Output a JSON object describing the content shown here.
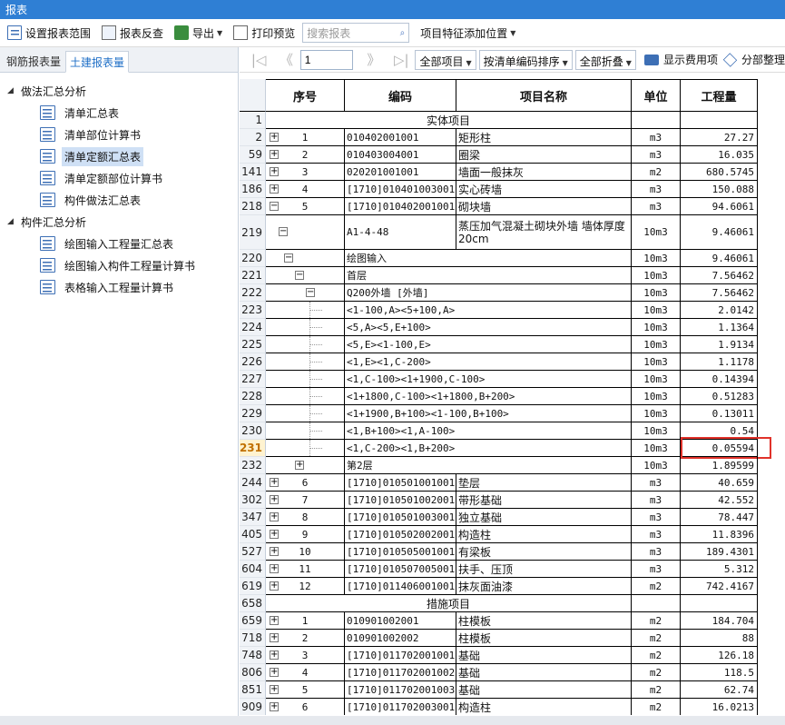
{
  "window": {
    "title": "报表"
  },
  "toolbar": {
    "set_range": "设置报表范围",
    "reverse_check": "报表反查",
    "export": "导出",
    "print_preview": "打印预览",
    "search_placeholder": "搜索报表",
    "feature_add": "项目特征添加位置"
  },
  "tabs": {
    "rebar": "钢筋报表量",
    "civil": "土建报表量"
  },
  "tree": {
    "group1": "做法汇总分析",
    "group1_items": [
      "清单汇总表",
      "清单部位计算书",
      "清单定额汇总表",
      "清单定额部位计算书",
      "构件做法汇总表"
    ],
    "group2": "构件汇总分析",
    "group2_items": [
      "绘图输入工程量汇总表",
      "绘图输入构件工程量计算书",
      "表格输入工程量计算书"
    ]
  },
  "nav": {
    "page": "1",
    "filter": "全部项目",
    "sort": "按清单编码排序",
    "fold": "全部折叠",
    "show_fee": "显示费用项",
    "section_sort": "分部整理"
  },
  "table": {
    "headers": {
      "seq": "序号",
      "code": "编码",
      "name": "项目名称",
      "unit": "单位",
      "qty": "工程量"
    },
    "rows": [
      {
        "rn": "1",
        "type": "section",
        "name": "实体项目"
      },
      {
        "rn": "2",
        "exp": "+",
        "seq": "1",
        "code": "010402001001",
        "name": "矩形柱",
        "unit": "m3",
        "qty": "27.27"
      },
      {
        "rn": "59",
        "exp": "+",
        "seq": "2",
        "code": "010403004001",
        "name": "圈梁",
        "unit": "m3",
        "qty": "16.035"
      },
      {
        "rn": "141",
        "exp": "+",
        "seq": "3",
        "code": "020201001001",
        "name": "墙面一般抹灰",
        "unit": "m2",
        "qty": "680.5745"
      },
      {
        "rn": "186",
        "exp": "+",
        "seq": "4",
        "code": "[1710]010401003001",
        "name": "实心砖墙",
        "unit": "m3",
        "qty": "150.088"
      },
      {
        "rn": "218",
        "exp": "−",
        "seq": "5",
        "code": "[1710]010402001001",
        "name": "砌块墙",
        "unit": "m3",
        "qty": "94.6061"
      },
      {
        "rn": "219",
        "type": "quota",
        "exp": "−",
        "code": "A1-4-48",
        "name": "蒸压加气混凝土砌块外墙 墙体厚度20cm",
        "unit": "10m3",
        "qty": "9.46061"
      },
      {
        "rn": "220",
        "type": "sub",
        "level": 1,
        "exp": "−",
        "text": "绘图输入",
        "unit": "10m3",
        "qty": "9.46061"
      },
      {
        "rn": "221",
        "type": "sub",
        "level": 2,
        "exp": "−",
        "text": "首层",
        "unit": "10m3",
        "qty": "7.56462"
      },
      {
        "rn": "222",
        "type": "sub",
        "level": 3,
        "exp": "−",
        "text": "Q200外墙 [外墙]",
        "unit": "10m3",
        "qty": "7.56462"
      },
      {
        "rn": "223",
        "type": "sub",
        "level": 4,
        "text": "<1-100,A><5+100,A>",
        "unit": "10m3",
        "qty": "2.0142"
      },
      {
        "rn": "224",
        "type": "sub",
        "level": 4,
        "text": "<5,A><5,E+100>",
        "unit": "10m3",
        "qty": "1.1364"
      },
      {
        "rn": "225",
        "type": "sub",
        "level": 4,
        "text": "<5,E><1-100,E>",
        "unit": "10m3",
        "qty": "1.9134"
      },
      {
        "rn": "226",
        "type": "sub",
        "level": 4,
        "text": "<1,E><1,C-200>",
        "unit": "10m3",
        "qty": "1.1178"
      },
      {
        "rn": "227",
        "type": "sub",
        "level": 4,
        "text": "<1,C-100><1+1900,C-100>",
        "unit": "10m3",
        "qty": "0.14394"
      },
      {
        "rn": "228",
        "type": "sub",
        "level": 4,
        "text": "<1+1800,C-100><1+1800,B+200>",
        "unit": "10m3",
        "qty": "0.51283"
      },
      {
        "rn": "229",
        "type": "sub",
        "level": 4,
        "text": "<1+1900,B+100><1-100,B+100>",
        "unit": "10m3",
        "qty": "0.13011"
      },
      {
        "rn": "230",
        "type": "sub",
        "level": 4,
        "text": "<1,B+100><1,A-100>",
        "unit": "10m3",
        "qty": "0.54"
      },
      {
        "rn": "231",
        "type": "sub",
        "level": 4,
        "cur": true,
        "text": "<1,C-200><1,B+200>",
        "unit": "10m3",
        "qty": "0.05594"
      },
      {
        "rn": "232",
        "type": "sub",
        "level": 2,
        "exp": "+",
        "text": "第2层",
        "unit": "10m3",
        "qty": "1.89599"
      },
      {
        "rn": "244",
        "exp": "+",
        "seq": "6",
        "code": "[1710]010501001001",
        "name": "垫层",
        "unit": "m3",
        "qty": "40.659"
      },
      {
        "rn": "302",
        "exp": "+",
        "seq": "7",
        "code": "[1710]010501002001",
        "name": "带形基础",
        "unit": "m3",
        "qty": "42.552"
      },
      {
        "rn": "347",
        "exp": "+",
        "seq": "8",
        "code": "[1710]010501003001",
        "name": "独立基础",
        "unit": "m3",
        "qty": "78.447"
      },
      {
        "rn": "405",
        "exp": "+",
        "seq": "9",
        "code": "[1710]010502002001",
        "name": "构造柱",
        "unit": "m3",
        "qty": "11.8396"
      },
      {
        "rn": "527",
        "exp": "+",
        "seq": "10",
        "code": "[1710]010505001001",
        "name": "有梁板",
        "unit": "m3",
        "qty": "189.4301"
      },
      {
        "rn": "604",
        "exp": "+",
        "seq": "11",
        "code": "[1710]010507005001",
        "name": "扶手、压顶",
        "unit": "m3",
        "qty": "5.312"
      },
      {
        "rn": "619",
        "exp": "+",
        "seq": "12",
        "code": "[1710]011406001001",
        "name": "抹灰面油漆",
        "unit": "m2",
        "qty": "742.4167"
      },
      {
        "rn": "658",
        "type": "section",
        "name": "措施项目"
      },
      {
        "rn": "659",
        "exp": "+",
        "seq": "1",
        "code": "010901002001",
        "name": "柱模板",
        "unit": "m2",
        "qty": "184.704"
      },
      {
        "rn": "718",
        "exp": "+",
        "seq": "2",
        "code": "010901002002",
        "name": "柱模板",
        "unit": "m2",
        "qty": "88"
      },
      {
        "rn": "748",
        "exp": "+",
        "seq": "3",
        "code": "[1710]011702001001",
        "name": "基础",
        "unit": "m2",
        "qty": "126.18"
      },
      {
        "rn": "806",
        "exp": "+",
        "seq": "4",
        "code": "[1710]011702001002",
        "name": "基础",
        "unit": "m2",
        "qty": "118.5"
      },
      {
        "rn": "851",
        "exp": "+",
        "seq": "5",
        "code": "[1710]011702001003",
        "name": "基础",
        "unit": "m2",
        "qty": "62.74"
      },
      {
        "rn": "909",
        "exp": "+",
        "seq": "6",
        "code": "[1710]011702003001",
        "name": "构造柱",
        "unit": "m2",
        "qty": "16.0213"
      }
    ]
  },
  "colors": {
    "titlebar": "#2f7fd4",
    "highlight": "#e0322a",
    "selected": "#cfe0f5"
  }
}
